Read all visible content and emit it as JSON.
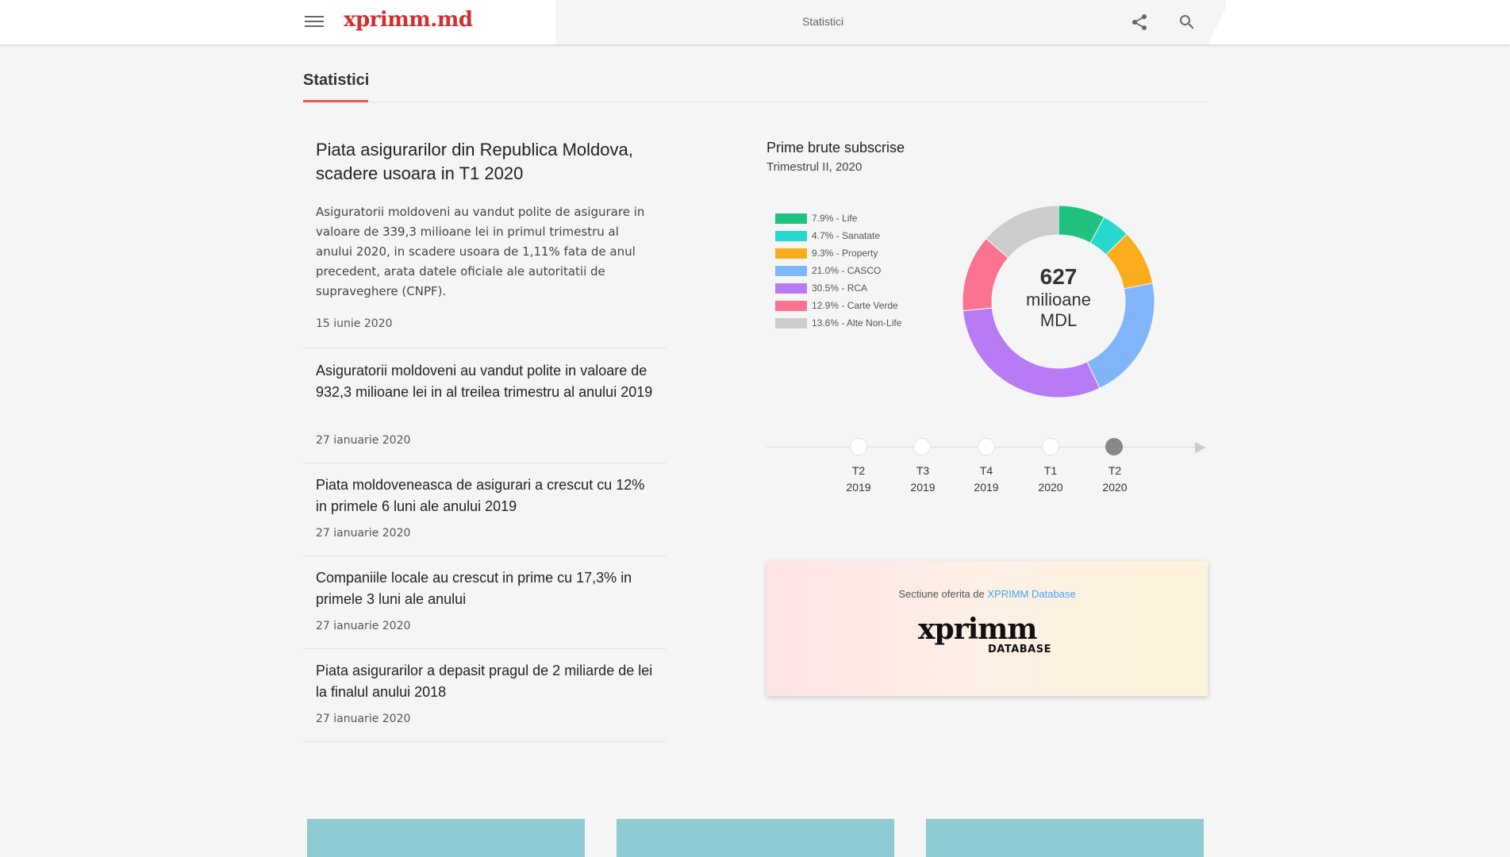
{
  "header": {
    "logo_text": "xprimm.md",
    "page_label": "Statistici"
  },
  "section": {
    "title": "Statistici"
  },
  "featured": {
    "title": "Piata asigurarilor din Republica Moldova, scadere usoara in T1 2020",
    "body": "Asiguratorii moldoveni au vandut polite de asigurare in valoare de 339,3 milioane lei in primul trimestru al anului 2020, in scadere usoara de 1,11% fata de anul precedent, arata datele oficiale ale autoritatii de supraveghere (CNPF).",
    "date": "15 iunie 2020"
  },
  "articles": [
    {
      "title": "Asiguratorii moldoveni au vandut polite in valoare de 932,3 milioane lei in al treilea trimestru al anului 2019",
      "date": "27 ianuarie 2020"
    },
    {
      "title": "Piata moldoveneasca de asigurari a crescut cu 12% in primele 6 luni ale anului 2019",
      "date": "27 ianuarie 2020"
    },
    {
      "title": "Companiile locale au crescut in prime cu 17,3% in primele 3 luni ale anului",
      "date": "27 ianuarie 2020"
    },
    {
      "title": "Piata asigurarilor a depasit pragul de 2 miliarde de lei la finalul anului 2018",
      "date": "27 ianuarie 2020"
    }
  ],
  "chart": {
    "title": "Prime brute subscrise",
    "subtitle": "Trimestrul II, 2020",
    "center_value": "627",
    "center_unit_1": "milioane",
    "center_unit_2": "MDL"
  },
  "chart_data": {
    "type": "pie",
    "title": "Prime brute subscrise",
    "subtitle": "Trimestrul II, 2020",
    "donut": true,
    "center_label": "627 milioane MDL",
    "legend_position": "left",
    "slices": [
      {
        "label": "7.9% - Life",
        "name": "Life",
        "value": 7.9,
        "color": "#1fc27e"
      },
      {
        "label": "4.7% - Sanatate",
        "name": "Sanatate",
        "value": 4.7,
        "color": "#27d8cf"
      },
      {
        "label": "9.3% - Property",
        "name": "Property",
        "value": 9.3,
        "color": "#f9ad1c"
      },
      {
        "label": "21.0% - CASCO",
        "name": "CASCO",
        "value": 21.0,
        "color": "#80b6f9"
      },
      {
        "label": "30.5% - RCA",
        "name": "RCA",
        "value": 30.5,
        "color": "#b97af6"
      },
      {
        "label": "12.9% - Carte Verde",
        "name": "Carte Verde",
        "value": 12.9,
        "color": "#fb7391"
      },
      {
        "label": "13.6% - Alte Non-Life",
        "name": "Alte Non-Life",
        "value": 13.6,
        "color": "#cccccc"
      }
    ]
  },
  "timeline": [
    {
      "q": "T2",
      "year": "2019",
      "active": false
    },
    {
      "q": "T3",
      "year": "2019",
      "active": false
    },
    {
      "q": "T4",
      "year": "2019",
      "active": false
    },
    {
      "q": "T1",
      "year": "2020",
      "active": false
    },
    {
      "q": "T2",
      "year": "2020",
      "active": true
    }
  ],
  "database": {
    "text_prefix": "Sectiune oferita de",
    "link_text": "XPRIMM Database",
    "logo_main": "xprimm",
    "logo_sub": "DATABASE"
  },
  "colors": {
    "accent": "#d32f2f",
    "underline": "#e05a5a",
    "link": "#42a5f5",
    "card": "#8ecbd3"
  }
}
